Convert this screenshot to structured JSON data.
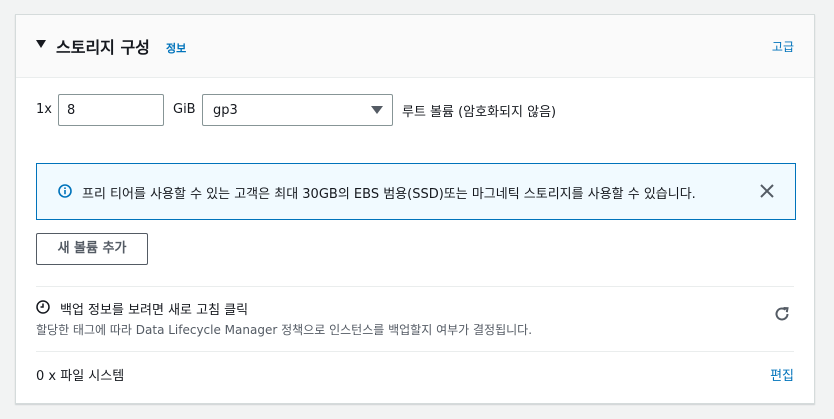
{
  "header": {
    "title": "스토리지 구성",
    "info_label": "정보",
    "advanced_label": "고급"
  },
  "volume": {
    "quantity_label": "1x",
    "size_value": "8",
    "unit_label": "GiB",
    "type_selected": "gp3",
    "root_label": "루트 볼륨  (암호화되지 않음)"
  },
  "alert": {
    "message": "프리 티어를 사용할 수 있는 고객은 최대 30GB의 EBS 범용(SSD)또는 마그네틱 스토리지를 사용할 수 있습니다.",
    "color_border": "#0073bb",
    "color_bg": "#f1faff"
  },
  "add_volume_label": "새 볼륨 추가",
  "backup": {
    "title": "백업 정보를 보려면 새로 고침 클릭",
    "description": "할당한 태그에 따라 Data Lifecycle Manager 정책으로 인스턴스를 백업할지 여부가 결정됩니다."
  },
  "file_systems": {
    "label": "0 x 파일 시스템",
    "edit_label": "편집"
  },
  "icons": [
    "caret-down-icon",
    "dropdown-arrow-icon",
    "info-icon",
    "close-icon",
    "clock-icon",
    "refresh-icon"
  ]
}
